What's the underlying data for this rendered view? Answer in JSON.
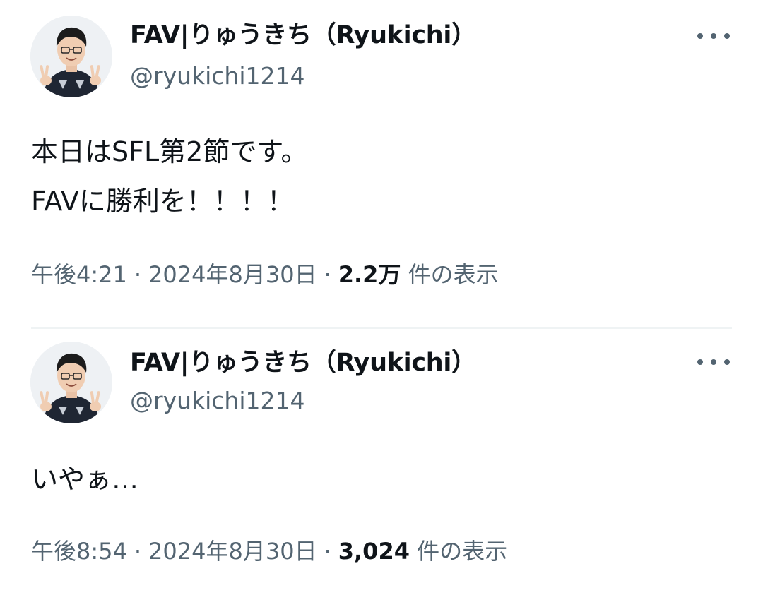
{
  "tweets": [
    {
      "author_name": "FAV|りゅうきち（Ryukichi）",
      "handle": "@ryukichi1214",
      "text": "本日はSFL第2節です。\nFAVに勝利を！！！！",
      "time": "午後4:21",
      "separator": "·",
      "date": "2024年8月30日",
      "views_count": "2.2万",
      "views_label": "件の表示",
      "more_icon": "more-horizontal-icon"
    },
    {
      "author_name": "FAV|りゅうきち（Ryukichi）",
      "handle": "@ryukichi1214",
      "text": "いやぁ…",
      "time": "午後8:54",
      "separator": "·",
      "date": "2024年8月30日",
      "views_count": "3,024",
      "views_label": "件の表示",
      "more_icon": "more-horizontal-icon"
    }
  ],
  "colors": {
    "text_primary": "#0f1419",
    "text_secondary": "#536471",
    "divider": "#eff3f4",
    "background": "#ffffff"
  }
}
